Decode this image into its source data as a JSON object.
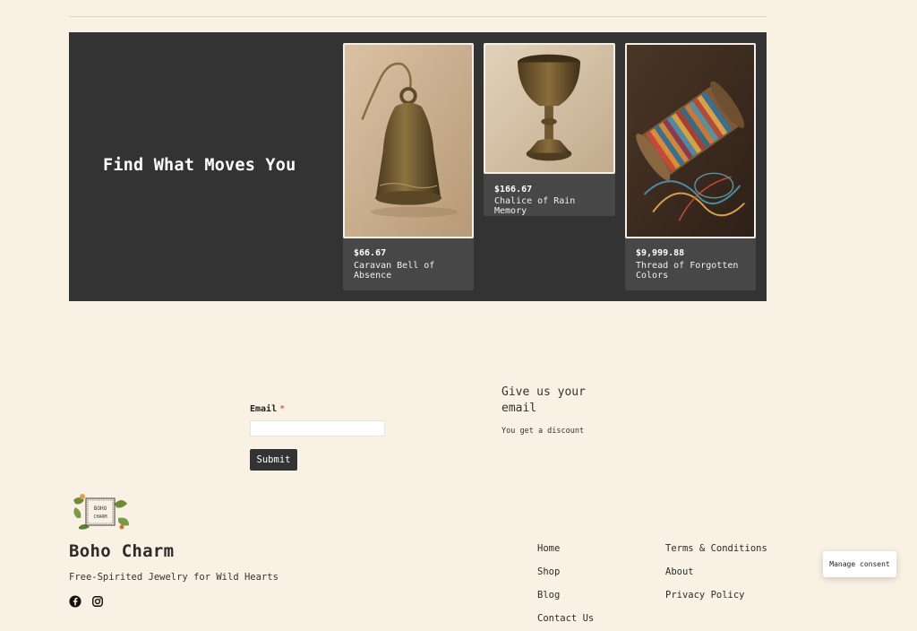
{
  "hero": {
    "title": "Find What Moves You",
    "products": [
      {
        "price": "$66.67",
        "name": "Caravan Bell of Absence",
        "image_icon": "brass-bell-image"
      },
      {
        "price": "$166.67",
        "name": "Chalice of Rain Memory",
        "image_icon": "brass-chalice-image"
      },
      {
        "price": "$9,999.88",
        "name": "Thread of Forgotten Colors",
        "image_icon": "thread-spool-image"
      }
    ]
  },
  "form": {
    "email_label": "Email",
    "required_marker": "*",
    "email_value": "",
    "submit_label": "Submit"
  },
  "promo": {
    "title": "Give us your email",
    "subtitle": "You get a discount"
  },
  "footer": {
    "logo_text": "BOHO CHARM",
    "brand_name": "Boho Charm",
    "tagline": "Free-Spirited Jewelry for Wild Hearts",
    "social": [
      "facebook-icon",
      "instagram-icon"
    ],
    "nav_col1": [
      "Home",
      "Shop",
      "Blog",
      "Contact Us"
    ],
    "nav_col2": [
      "Terms & Conditions",
      "About",
      "Privacy Policy"
    ]
  },
  "consent": {
    "label": "Manage consent"
  },
  "colors": {
    "background": "#f9f2e4",
    "hero": "#333333",
    "card": "#474747",
    "required": "#c8322d"
  }
}
